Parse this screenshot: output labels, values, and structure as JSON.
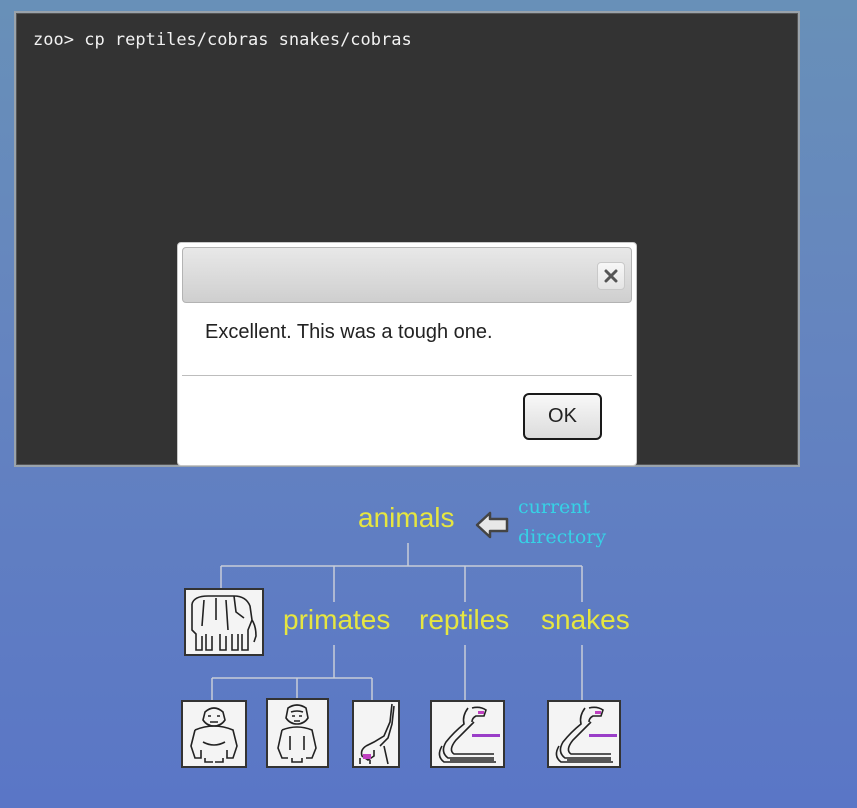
{
  "terminal": {
    "prompt": "zoo>",
    "command": "cp reptiles/cobras snakes/cobras"
  },
  "dialog": {
    "message": "Excellent. This was a tough one.",
    "ok_label": "OK",
    "close_icon": "close-icon"
  },
  "tree": {
    "root_label": "animals",
    "current_hint_line1": "current",
    "current_hint_line2": "directory",
    "children": [
      {
        "label": "",
        "icon": "elephant-icon"
      },
      {
        "label": "primates",
        "icon": ""
      },
      {
        "label": "reptiles",
        "icon": ""
      },
      {
        "label": "snakes",
        "icon": ""
      }
    ],
    "primates_children": [
      "gorilla-icon",
      "ape-icon",
      "monkey-icon"
    ],
    "reptiles_child": "cobra-icon",
    "snakes_child": "cobra-icon"
  },
  "colors": {
    "tree_label": "#e6e640",
    "hint_label": "#36d2e6",
    "terminal_bg": "#333333"
  }
}
